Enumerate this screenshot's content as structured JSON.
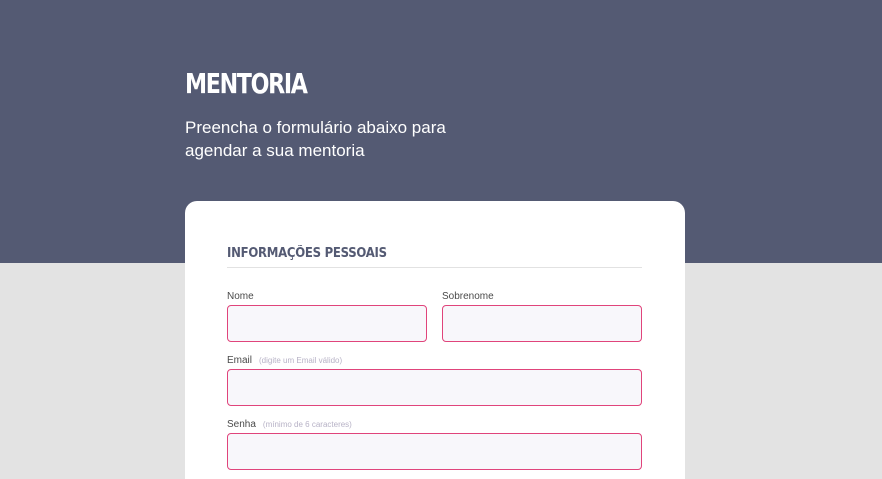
{
  "hero": {
    "title": "MENTORIA",
    "subtitle": "Preencha o formulário abaixo para agendar a sua mentoria"
  },
  "form": {
    "section_title": "INFORMAÇÕES PESSOAIS",
    "fields": {
      "first_name": {
        "label": "Nome",
        "value": ""
      },
      "last_name": {
        "label": "Sobrenome",
        "value": ""
      },
      "email": {
        "label": "Email",
        "hint": "(digite um Email válido)",
        "value": ""
      },
      "password": {
        "label": "Senha",
        "hint": "(mínimo de 6 caracteres)",
        "value": ""
      }
    }
  },
  "colors": {
    "hero_bg": "#545a73",
    "page_bg": "#e3e3e3",
    "input_border": "#e0447b",
    "input_bg": "#f8f7fb"
  }
}
